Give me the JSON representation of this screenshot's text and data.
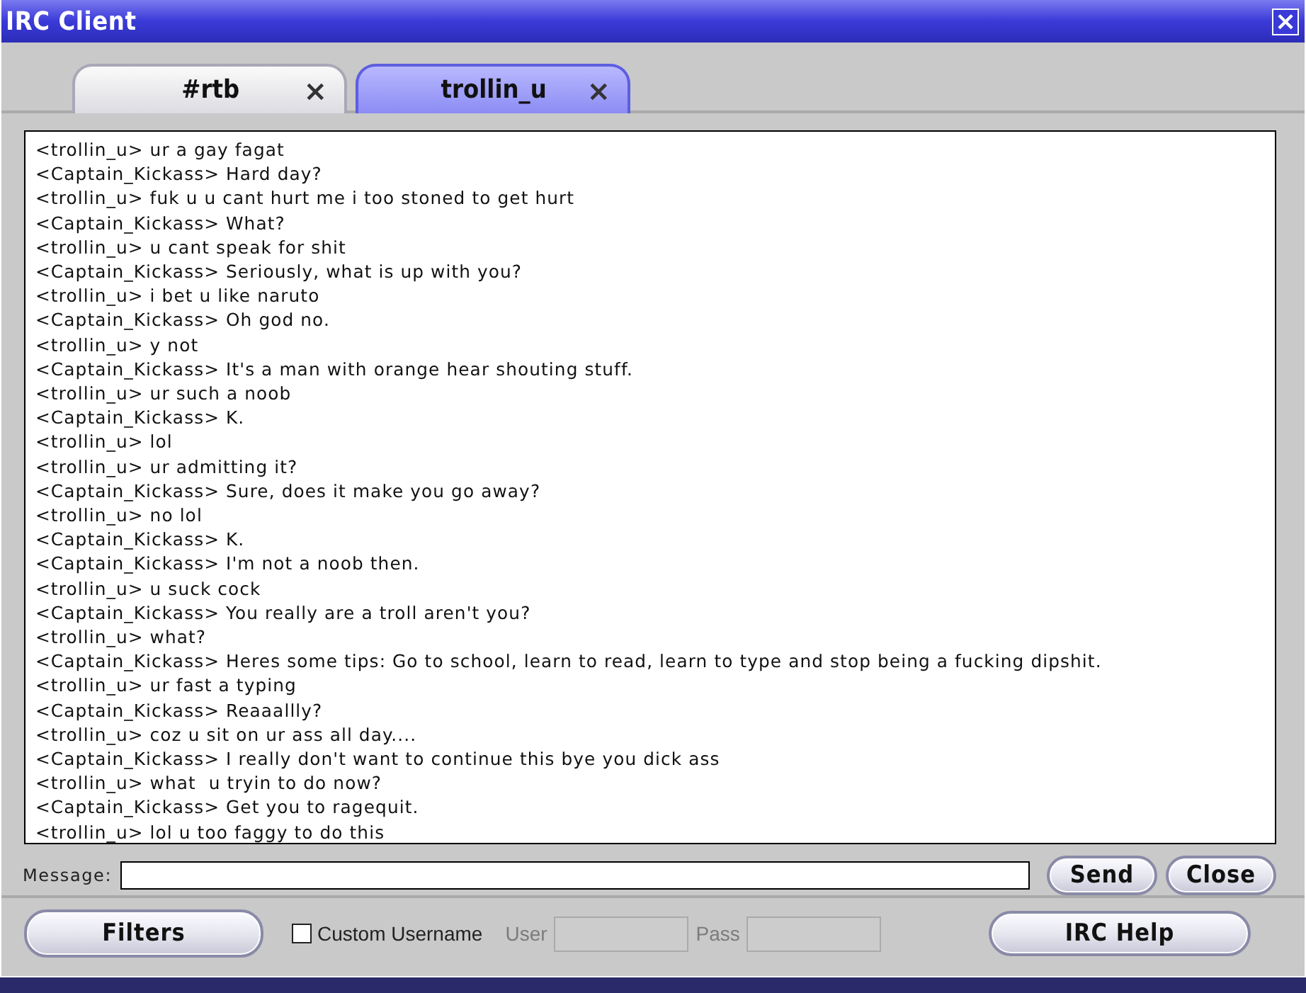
{
  "window": {
    "title": "IRC Client",
    "close_glyph": "×"
  },
  "tabs": [
    {
      "label": "#rtb",
      "selected": false,
      "close_glyph": "×"
    },
    {
      "label": "trollin_u",
      "selected": true,
      "close_glyph": "×"
    }
  ],
  "chat_lines": [
    "<trollin_u> ur a gay fagat",
    "<Captain_Kickass> Hard day?",
    "<trollin_u> fuk u u cant hurt me i too stoned to get hurt",
    "<Captain_Kickass> What?",
    "<trollin_u> u cant speak for shit",
    "<Captain_Kickass> Seriously, what is up with you?",
    "<trollin_u> i bet u like naruto",
    "<Captain_Kickass> Oh god no.",
    "<trollin_u> y not",
    "<Captain_Kickass> It's a man with orange hear shouting stuff.",
    "<trollin_u> ur such a noob",
    "<Captain_Kickass> K.",
    "<trollin_u> lol",
    "<trollin_u> ur admitting it?",
    "<Captain_Kickass> Sure, does it make you go away?",
    "<trollin_u> no lol",
    "<Captain_Kickass> K.",
    "<Captain_Kickass> I'm not a noob then.",
    "<trollin_u> u suck cock",
    "<Captain_Kickass> You really are a troll aren't you?",
    "<trollin_u> what?",
    "<Captain_Kickass> Heres some tips: Go to school, learn to read, learn to type and stop being a fucking dipshit.",
    "<trollin_u> ur fast a typing",
    "<Captain_Kickass> Reaaallly?",
    "<trollin_u> coz u sit on ur ass all day....",
    "<Captain_Kickass> I really don't want to continue this bye you dick ass",
    "<trollin_u> what  u tryin to do now?",
    "<Captain_Kickass> Get you to ragequit.",
    "<trollin_u> lol u too faggy to do this"
  ],
  "message": {
    "label": "Message:"
  },
  "message_buttons": [
    "Send",
    "Close"
  ],
  "bottom": {
    "filters_button": "Filters",
    "custom_username": {
      "label": "Custom Username",
      "checked": false
    },
    "user": {
      "label": "User",
      "disabled": true
    },
    "pass": {
      "label": "Pass",
      "disabled": true
    },
    "help_button": "IRC Help"
  }
}
